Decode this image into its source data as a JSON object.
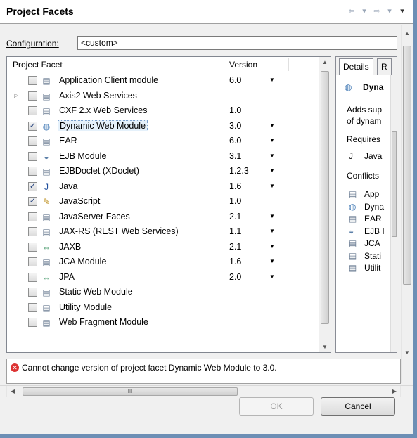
{
  "window": {
    "title": "Project Facets"
  },
  "config": {
    "label": "Configuration:",
    "value": "<custom>"
  },
  "table": {
    "headers": {
      "facet": "Project Facet",
      "version": "Version"
    },
    "rows": [
      {
        "name": "Application Client module",
        "version": "6.0",
        "checked": false,
        "dropdown": true,
        "icon": "document-icon"
      },
      {
        "name": "Axis2 Web Services",
        "version": "",
        "checked": false,
        "dropdown": false,
        "icon": "document-icon",
        "expandable": true
      },
      {
        "name": "CXF 2.x Web Services",
        "version": "1.0",
        "checked": false,
        "dropdown": false,
        "icon": "document-icon"
      },
      {
        "name": "Dynamic Web Module",
        "version": "3.0",
        "checked": true,
        "dropdown": true,
        "icon": "globe-icon",
        "selected": true
      },
      {
        "name": "EAR",
        "version": "6.0",
        "checked": false,
        "dropdown": true,
        "icon": "document-icon"
      },
      {
        "name": "EJB Module",
        "version": "3.1",
        "checked": false,
        "dropdown": true,
        "icon": "bean-icon"
      },
      {
        "name": "EJBDoclet (XDoclet)",
        "version": "1.2.3",
        "checked": false,
        "dropdown": true,
        "icon": "document-icon"
      },
      {
        "name": "Java",
        "version": "1.6",
        "checked": true,
        "dropdown": true,
        "icon": "java-icon"
      },
      {
        "name": "JavaScript",
        "version": "1.0",
        "checked": true,
        "dropdown": false,
        "icon": "javascript-icon"
      },
      {
        "name": "JavaServer Faces",
        "version": "2.1",
        "checked": false,
        "dropdown": true,
        "icon": "document-icon"
      },
      {
        "name": "JAX-RS (REST Web Services)",
        "version": "1.1",
        "checked": false,
        "dropdown": true,
        "icon": "document-icon"
      },
      {
        "name": "JAXB",
        "version": "2.1",
        "checked": false,
        "dropdown": true,
        "icon": "arrows-icon"
      },
      {
        "name": "JCA Module",
        "version": "1.6",
        "checked": false,
        "dropdown": true,
        "icon": "document-icon"
      },
      {
        "name": "JPA",
        "version": "2.0",
        "checked": false,
        "dropdown": true,
        "icon": "arrows-icon"
      },
      {
        "name": "Static Web Module",
        "version": "",
        "checked": false,
        "dropdown": false,
        "icon": "document-icon"
      },
      {
        "name": "Utility Module",
        "version": "",
        "checked": false,
        "dropdown": false,
        "icon": "document-icon"
      },
      {
        "name": "Web Fragment Module",
        "version": "",
        "checked": false,
        "dropdown": false,
        "icon": "document-icon"
      }
    ]
  },
  "details": {
    "tabs": [
      "Details",
      "R"
    ],
    "heading": "Dyna",
    "desc1": "Adds sup",
    "desc2": "of dynam",
    "requires_label": "Requires",
    "requires_item": "Java",
    "conflicts_label": "Conflicts",
    "conflicts_items": [
      "App",
      "Dyna",
      "EAR",
      "EJB I",
      "JCA",
      "Stati",
      "Utilit"
    ]
  },
  "message": {
    "text": "Cannot change version of project facet Dynamic Web Module to 3.0."
  },
  "hscroll": {
    "thumb_grip": "III"
  },
  "buttons": {
    "ok": "OK",
    "cancel": "Cancel"
  },
  "colors": {
    "accent": "#7da2ce",
    "error": "#dd3333",
    "window_frame": "#6d8fb5"
  }
}
